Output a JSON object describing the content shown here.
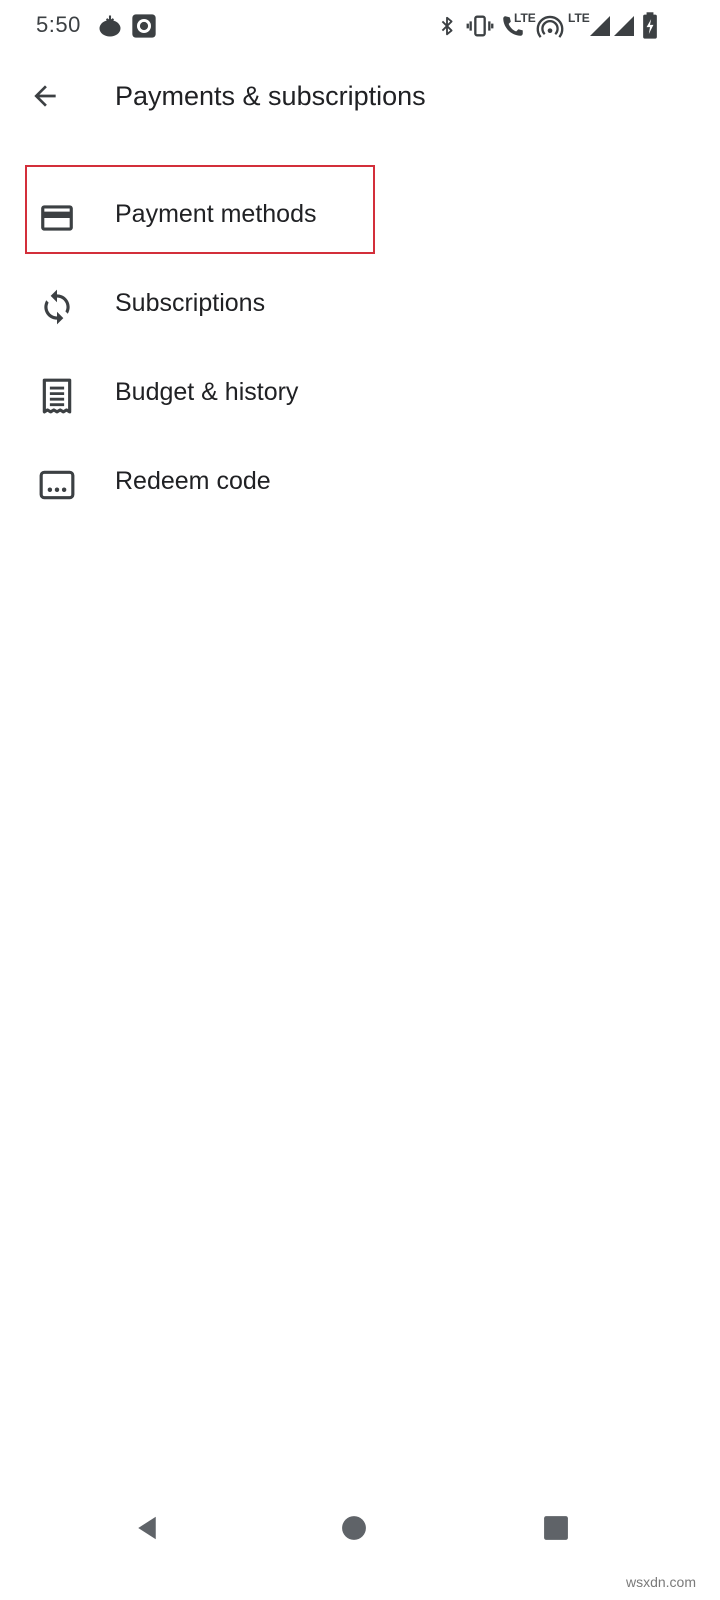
{
  "status_bar": {
    "time": "5:50",
    "lte_label_call": "LTE",
    "lte_label_data": "LTE",
    "icons": [
      "tomato-notification-icon",
      "camera-notification-icon",
      "bluetooth-icon",
      "vibrate-icon",
      "lte-call-icon",
      "hotspot-icon",
      "signal-icon-1",
      "signal-icon-2",
      "battery-charging-icon"
    ]
  },
  "app_bar": {
    "title": "Payments & subscriptions",
    "back_icon": "arrow-back-icon"
  },
  "menu": {
    "items": [
      {
        "label": "Payment methods",
        "icon": "credit-card-icon",
        "highlighted": true
      },
      {
        "label": "Subscriptions",
        "icon": "sync-icon",
        "highlighted": false
      },
      {
        "label": "Budget & history",
        "icon": "receipt-icon",
        "highlighted": false
      },
      {
        "label": "Redeem code",
        "icon": "redeem-code-icon",
        "highlighted": false
      }
    ]
  },
  "nav_bar": {
    "buttons": [
      "nav-back-icon",
      "nav-home-icon",
      "nav-recents-icon"
    ]
  },
  "colors": {
    "text_primary": "#202124",
    "icon": "#3c4043",
    "highlight": "#d32f3a",
    "nav_icon": "#5f6368"
  },
  "watermark": "wsxdn.com"
}
